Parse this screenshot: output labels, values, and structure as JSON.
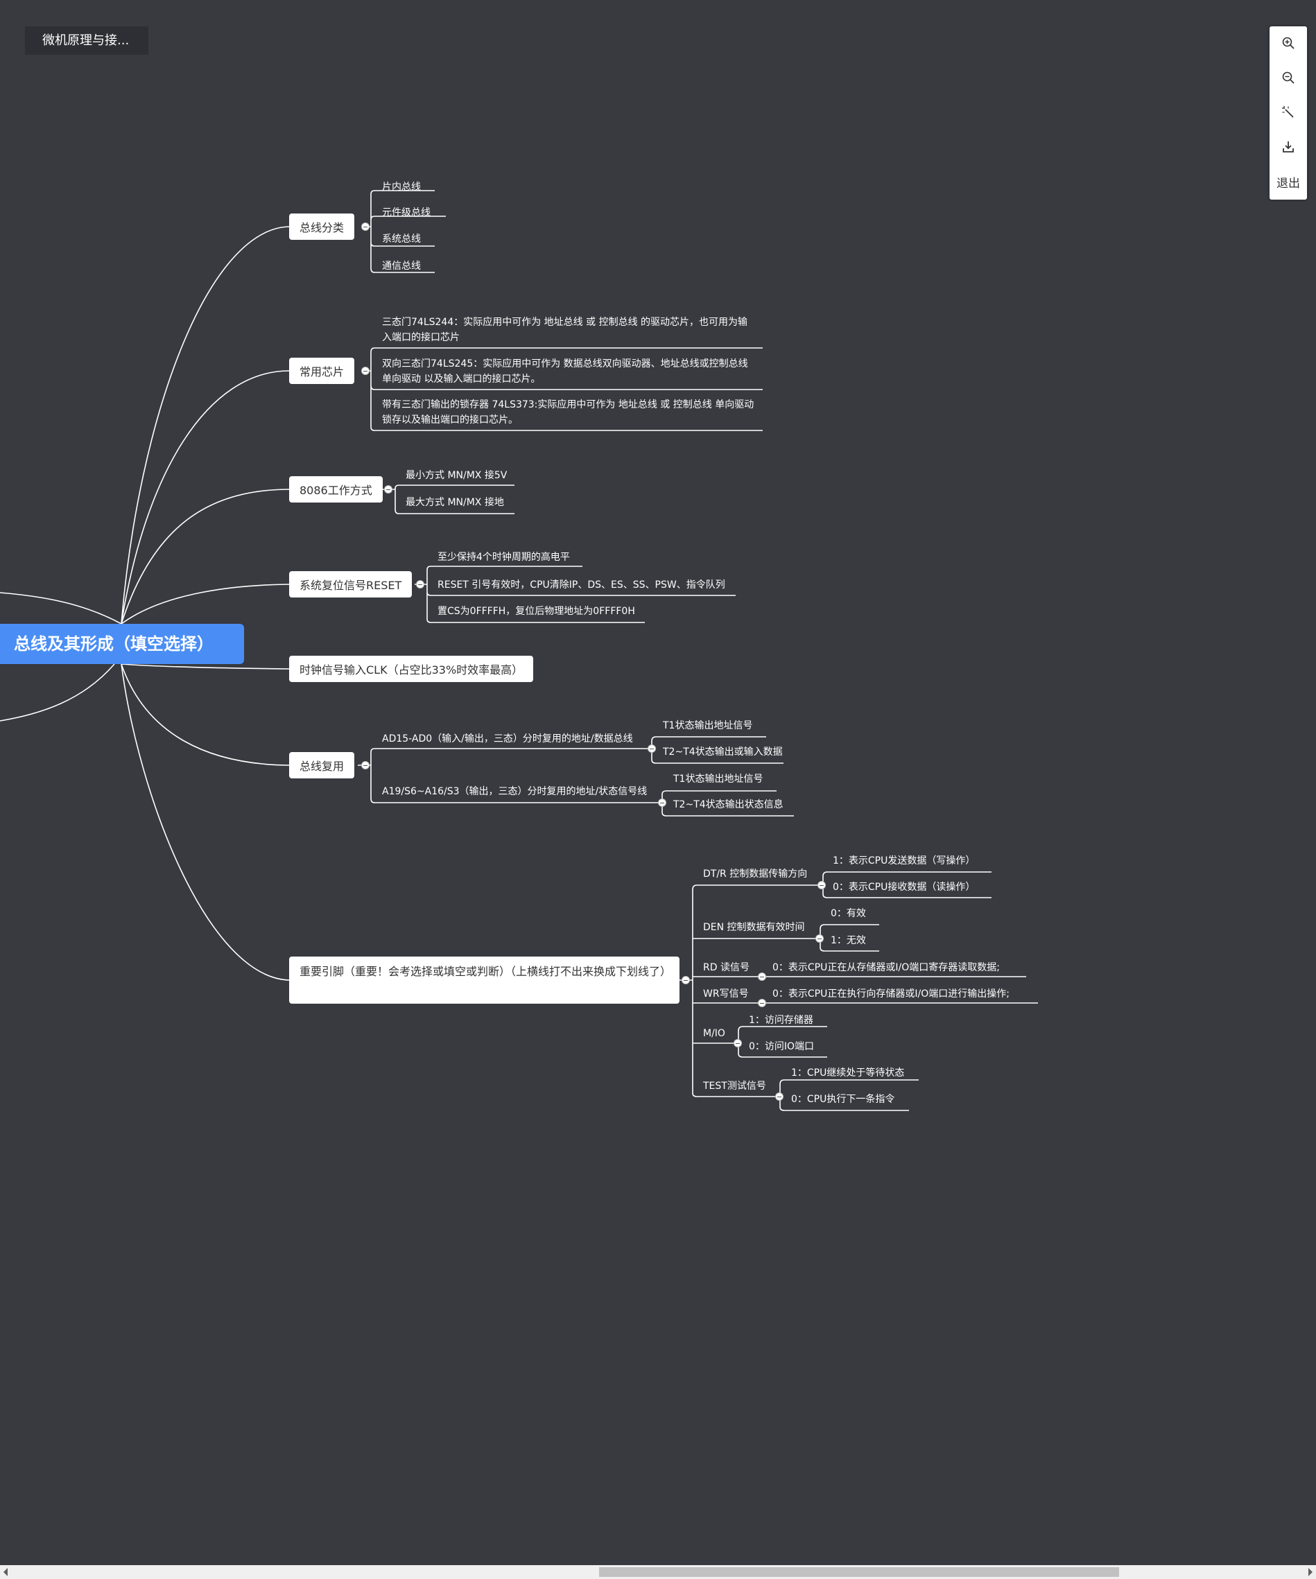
{
  "breadcrumb": "微机原理与接...",
  "toolbar": {
    "zoom_in": "zoom-in-icon",
    "zoom_out": "zoom-out-icon",
    "magic": "magic-wand-icon",
    "download": "download-icon",
    "exit_label": "退出"
  },
  "root": "总线及其形成（填空选择）",
  "branches": {
    "bus_class": {
      "label": "总线分类",
      "items": [
        "片内总线",
        "元件级总线",
        "系统总线",
        "通信总线"
      ]
    },
    "chips": {
      "label": "常用芯片",
      "items": [
        "三态门74LS244：实际应用中可作为 地址总线 或 控制总线 的驱动芯片，也可用为输入端口的接口芯片",
        "双向三态门74LS245：实际应用中可作为 数据总线双向驱动器、地址总线或控制总线单向驱动 以及输入端口的接口芯片。",
        "带有三态门输出的锁存器 74LS373:实际应用中可作为 地址总线 或 控制总线 单向驱动锁存以及输出端口的接口芯片。"
      ]
    },
    "mode": {
      "label": "8086工作方式",
      "items": [
        "最小方式 MN/MX 接5V",
        "最大方式 MN/MX 接地"
      ]
    },
    "reset": {
      "label": "系统复位信号RESET",
      "items": [
        "至少保持4个时钟周期的高电平",
        "RESET 引号有效时，CPU清除IP、DS、ES、SS、PSW、指令队列",
        "置CS为0FFFFH，复位后物理地址为0FFFF0H"
      ]
    },
    "clk": {
      "label": "时钟信号输入CLK（占空比33%时效率最高）"
    },
    "mux": {
      "label": "总线复用",
      "sub": [
        {
          "label": "AD15-AD0（输入/输出，三态）分时复用的地址/数据总线",
          "items": [
            "T1状态输出地址信号",
            "T2~T4状态输出或输入数据"
          ]
        },
        {
          "label": "A19/S6~A16/S3（输出，三态）分时复用的地址/状态信号线",
          "items": [
            "T1状态输出地址信号",
            "T2~T4状态输出状态信息"
          ]
        }
      ]
    },
    "pins": {
      "label": "重要引脚（重要！会考选择或填空或判断）（上横线打不出来换成下划线了）",
      "sub": [
        {
          "label": "DT/R 控制数据传输方向",
          "items": [
            "1：表示CPU发送数据（写操作）",
            "0：表示CPU接收数据（读操作）"
          ]
        },
        {
          "label": "DEN 控制数据有效时间",
          "items": [
            "0：有效",
            "1：无效"
          ]
        },
        {
          "label": "RD 读信号",
          "items": [
            "0：表示CPU正在从存储器或I/O端口寄存器读取数据;"
          ]
        },
        {
          "label": "WR写信号",
          "items": [
            "0：表示CPU正在执行向存储器或I/O端口进行输出操作;"
          ]
        },
        {
          "label": "M/IO",
          "items": [
            "1：访问存储器",
            "0：访问IO端口"
          ]
        },
        {
          "label": "TEST测试信号",
          "items": [
            "1：CPU继续处于等待状态",
            "0：CPU执行下一条指令"
          ]
        }
      ]
    }
  }
}
